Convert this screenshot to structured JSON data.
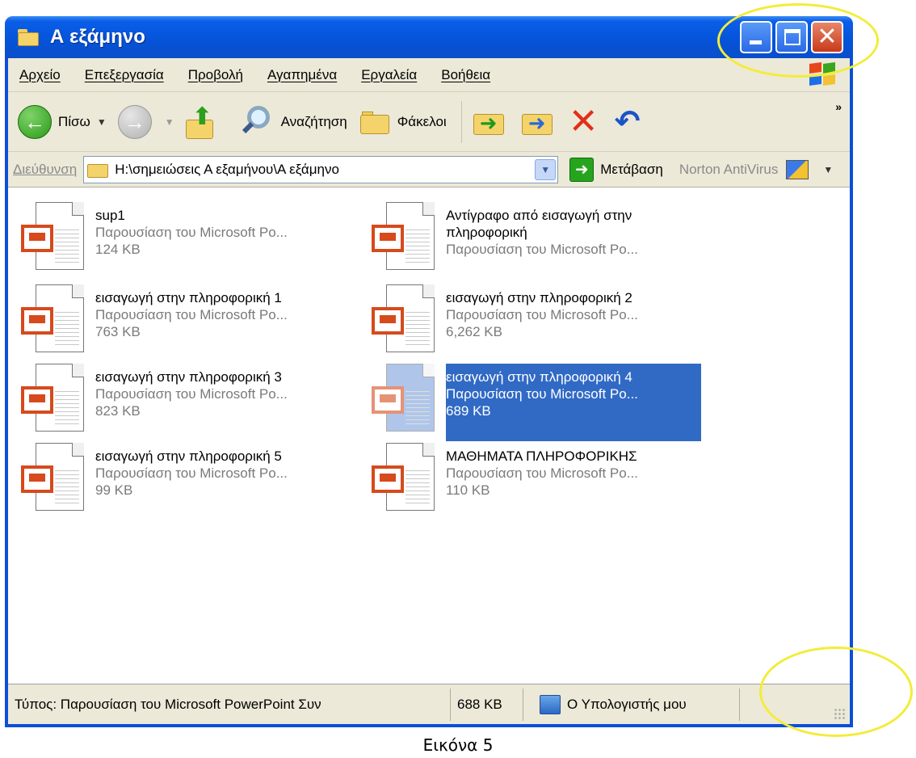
{
  "window": {
    "title": "Α εξάμηνο"
  },
  "menu": [
    "Αρχείο",
    "Επεξεργασία",
    "Προβολή",
    "Αγαπημένα",
    "Εργαλεία",
    "Βοήθεια"
  ],
  "toolbar": {
    "back_label": "Πίσω",
    "search_label": "Αναζήτηση",
    "folders_label": "Φάκελοι",
    "overflow": "»"
  },
  "address": {
    "label": "Διεύθυνση",
    "value": "H:\\σημειώσεις Α εξαμήνου\\Α εξάμηνο",
    "go_label": "Μετάβαση",
    "norton_label": "Norton AntiVirus"
  },
  "files": [
    {
      "name": "sup1",
      "type": "Παρουσίαση του Microsoft Po...",
      "size": "124 KB",
      "selected": false
    },
    {
      "name": "Αντίγραφο από εισαγωγή στην πληροφορική",
      "type": "Παρουσίαση του Microsoft Po...",
      "size": "",
      "selected": false
    },
    {
      "name": "εισαγωγή στην πληροφορική 1",
      "type": "Παρουσίαση του Microsoft Po...",
      "size": "763 KB",
      "selected": false
    },
    {
      "name": "εισαγωγή στην πληροφορική 2",
      "type": "Παρουσίαση του Microsoft Po...",
      "size": "6,262 KB",
      "selected": false
    },
    {
      "name": "εισαγωγή στην πληροφορική 3",
      "type": "Παρουσίαση του Microsoft Po...",
      "size": "823 KB",
      "selected": false
    },
    {
      "name": "εισαγωγή στην πληροφορική 4",
      "type": "Παρουσίαση του Microsoft Po...",
      "size": "689 KB",
      "selected": true
    },
    {
      "name": "εισαγωγή στην πληροφορική 5",
      "type": "Παρουσίαση του Microsoft Po...",
      "size": "99 KB",
      "selected": false
    },
    {
      "name": "ΜΑΘΗΜΑΤΑ ΠΛΗΡΟΦΟΡΙΚΗΣ",
      "type": "Παρουσίαση του Microsoft Po...",
      "size": "110 KB",
      "selected": false
    }
  ],
  "status": {
    "type_text": "Τύπος: Παρουσίαση του Microsoft PowerPoint Συν",
    "size_text": "688 KB",
    "location_text": "Ο Υπολογιστής μου"
  },
  "caption": "Εικόνα 5",
  "colors": {
    "titlebar": "#0553d8",
    "selection": "#316ac5",
    "highlight_circle": "#f3ec3a"
  }
}
